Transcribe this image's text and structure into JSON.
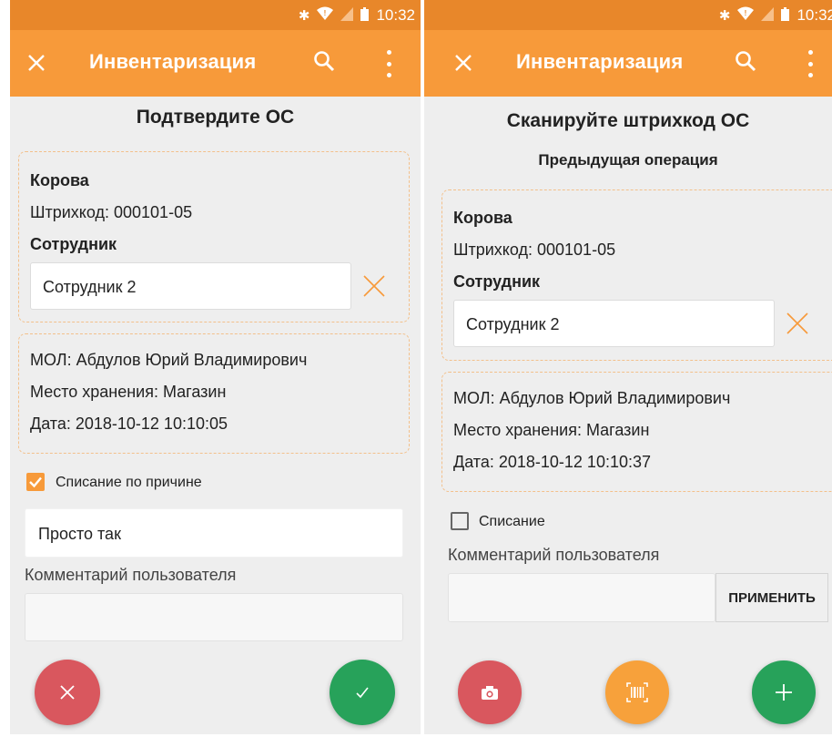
{
  "colors": {
    "status_bar": "#e8872a",
    "app_bar": "#f79a3a",
    "accent": "#f79a3a",
    "screen_bg": "#eeeeee",
    "fab_red": "#d9575e",
    "fab_green": "#27a25a",
    "fab_orange": "#f7a13b"
  },
  "status_bar": {
    "time": "10:32",
    "icons": [
      "bluetooth-icon",
      "wifi-icon",
      "signal-icon",
      "battery-icon"
    ]
  },
  "screen1": {
    "app_bar": {
      "title": "Инвентаризация",
      "close_icon": "close-icon",
      "search_icon": "search-icon",
      "menu_icon": "more-vert-icon"
    },
    "heading": "Подтвердите ОС",
    "asset_card": {
      "name": "Корова",
      "barcode": "Штрихкод: 000101-05",
      "employee_label": "Сотрудник",
      "employee_value": "Сотрудник 2"
    },
    "details_card": {
      "mol": "МОЛ: Абдулов Юрий Владимирович",
      "location": "Место хранения: Магазин",
      "date": "Дата: 2018-10-12 10:10:05"
    },
    "writeoff": {
      "label": "Списание по причине",
      "checked": true,
      "reason": "Просто так"
    },
    "comment_label": "Комментарий пользователя",
    "comment_value": "",
    "fabs": {
      "cancel_icon": "close-icon",
      "confirm_icon": "check-icon"
    }
  },
  "screen2": {
    "app_bar": {
      "title": "Инвентаризация",
      "close_icon": "close-icon",
      "search_icon": "search-icon",
      "menu_icon": "more-vert-icon"
    },
    "heading": "Сканируйте штрихкод ОС",
    "subheading": "Предыдущая операция",
    "asset_card": {
      "name": "Корова",
      "barcode": "Штрихкод: 000101-05",
      "employee_label": "Сотрудник",
      "employee_value": "Сотрудник 2"
    },
    "details_card": {
      "mol": "МОЛ: Абдулов Юрий Владимирович",
      "location": "Место хранения: Магазин",
      "date": "Дата: 2018-10-12 10:10:37"
    },
    "writeoff": {
      "label": "Списание",
      "checked": false
    },
    "comment_label": "Комментарий пользователя",
    "comment_value": "",
    "apply_button": "ПРИМЕНИТЬ",
    "fabs": {
      "photo_icon": "camera-icon",
      "scan_icon": "barcode-icon",
      "add_icon": "plus-icon"
    }
  }
}
